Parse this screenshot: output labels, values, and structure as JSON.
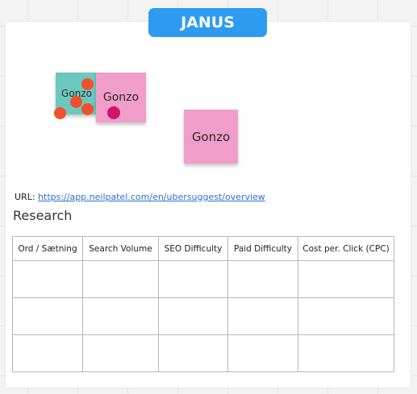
{
  "board": {
    "title": "JANUS",
    "url_label": "URL:",
    "url": "https://app.neilpatel.com/en/ubersuggest/overview",
    "section_title": "Research"
  },
  "stickies": [
    {
      "text": "Gonzo",
      "color": "#6cc8bf"
    },
    {
      "text": "Gonzo",
      "color": "#f09dca"
    },
    {
      "text": "Gonzo",
      "color": "#f09dca"
    }
  ],
  "cursor_colors": {
    "orange": "#f0502b",
    "magenta": "#d0136f"
  },
  "table": {
    "headers": [
      "Ord / Sætning",
      "Search Volume",
      "SEO Difficulty",
      "Paid Difficulty",
      "Cost per. Click (CPC)"
    ],
    "rows": [
      [
        "",
        "",
        "",
        "",
        ""
      ],
      [
        "",
        "",
        "",
        "",
        ""
      ],
      [
        "",
        "",
        "",
        "",
        ""
      ]
    ]
  }
}
